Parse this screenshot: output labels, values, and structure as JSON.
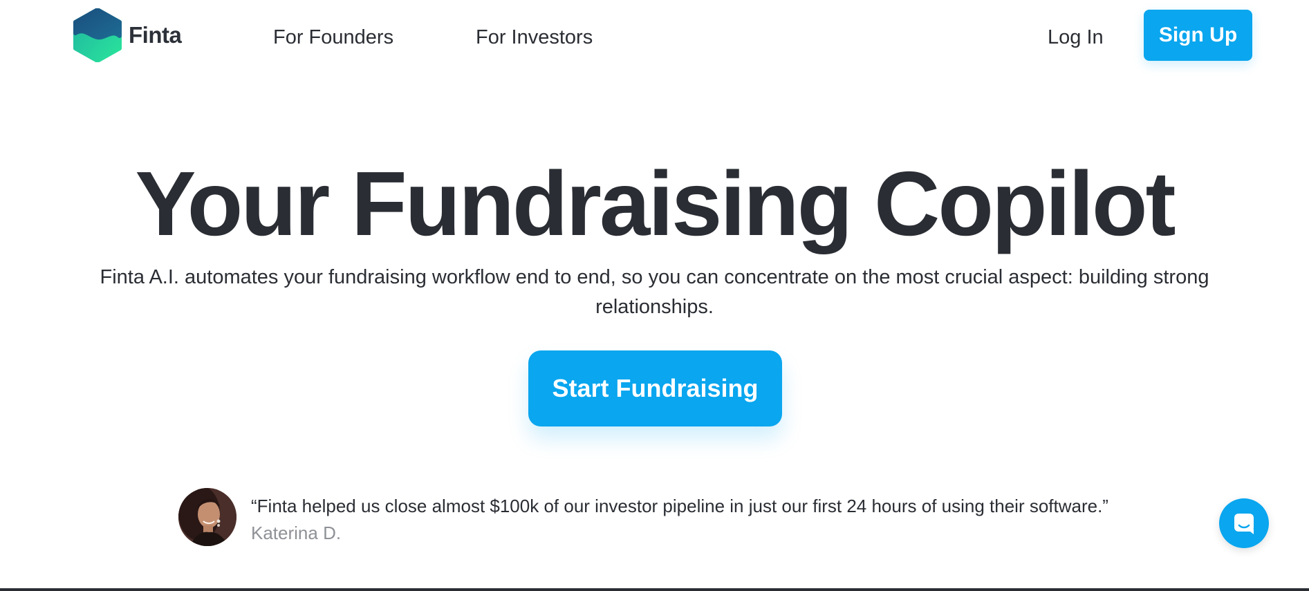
{
  "nav": {
    "logo_text": "Finta",
    "links": [
      "For Founders",
      "For Investors"
    ],
    "login_label": "Log In",
    "signup_label": "Sign Up"
  },
  "hero": {
    "title": "Your Fundraising Copilot",
    "subtitle": "Finta A.I. automates your fundraising workflow end to end, so you can concentrate on the most crucial aspect: building strong relationships.",
    "cta_label": "Start Fundraising"
  },
  "testimonial": {
    "quote": "“Finta helped us close almost $100k of our investor pipeline in just our first 24 hours of using their software.”",
    "author": "Katerina D."
  },
  "icons": {
    "logo": "finta-logo-icon",
    "chat": "chat-icon",
    "avatar": "avatar"
  },
  "colors": {
    "accent": "#0aa6ef",
    "text": "#2a2d33",
    "muted": "#8e9196",
    "logo_gradient": [
      "#1b5a86",
      "#1fb9a3",
      "#27e39d"
    ]
  }
}
